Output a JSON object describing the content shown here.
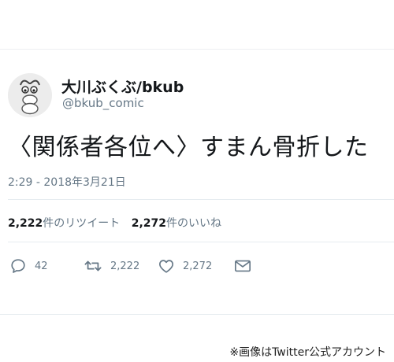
{
  "tweet": {
    "display_name": "大川ぶくぶ/bkub",
    "handle": "@bkub_comic",
    "text": "〈関係者各位へ〉すまん骨折した",
    "timestamp": "2:29 - 2018年3月21日"
  },
  "stats": {
    "retweets_count": "2,222",
    "retweets_label": "件のリツイート",
    "likes_count": "2,272",
    "likes_label": "件のいいね"
  },
  "actions": {
    "reply_icon": "reply-icon",
    "reply_count": "42",
    "retweet_icon": "retweet-icon",
    "retweet_count": "2,222",
    "like_icon": "heart-icon",
    "like_count": "2,272",
    "dm_icon": "envelope-icon"
  },
  "caption": "※画像はTwitter公式アカウント",
  "colors": {
    "text_primary": "#14171a",
    "text_secondary": "#657786",
    "divider": "#e6ecf0"
  }
}
